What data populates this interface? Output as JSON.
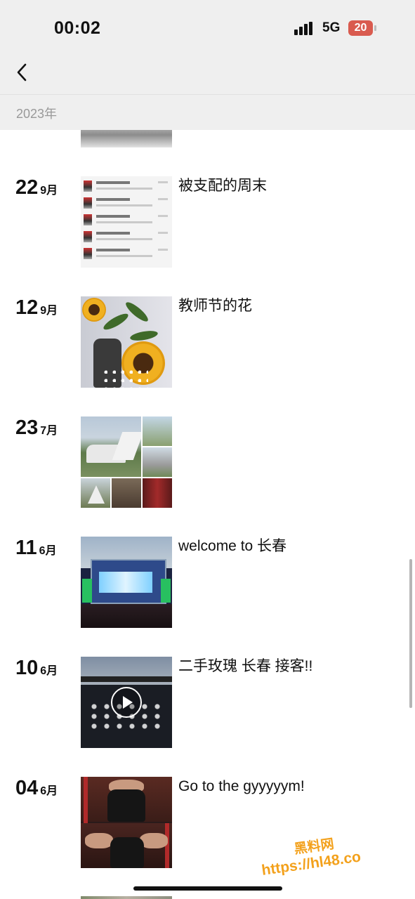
{
  "status_bar": {
    "time": "00:02",
    "network": "5G",
    "battery": "20"
  },
  "nav": {
    "back_icon": "chevron-left-icon"
  },
  "section": {
    "year": "2023年"
  },
  "posts": [
    {
      "day": "22",
      "month": "9月",
      "caption": "被支配的周末",
      "thumb": "chat-list-screenshot"
    },
    {
      "day": "12",
      "month": "9月",
      "caption": "教师节的花",
      "thumb": "sunflower-bouquet"
    },
    {
      "day": "23",
      "month": "7月",
      "caption": "",
      "thumb": "outdoor-photo-grid"
    },
    {
      "day": "11",
      "month": "6月",
      "caption": "welcome to 长春",
      "thumb": "concert-stage"
    },
    {
      "day": "10",
      "month": "6月",
      "caption": "二手玫瑰 长春 接客!!",
      "thumb": "concert-video"
    },
    {
      "day": "04",
      "month": "6月",
      "caption": "Go to the gyyyyym!",
      "thumb": "gym-photos"
    }
  ],
  "watermark": {
    "line1": "黑料网",
    "line2": "https://hl48.co"
  },
  "colors": {
    "accent": "#f3a11c",
    "battery_low": "#d95b4f",
    "topbar_bg": "#efefef"
  }
}
